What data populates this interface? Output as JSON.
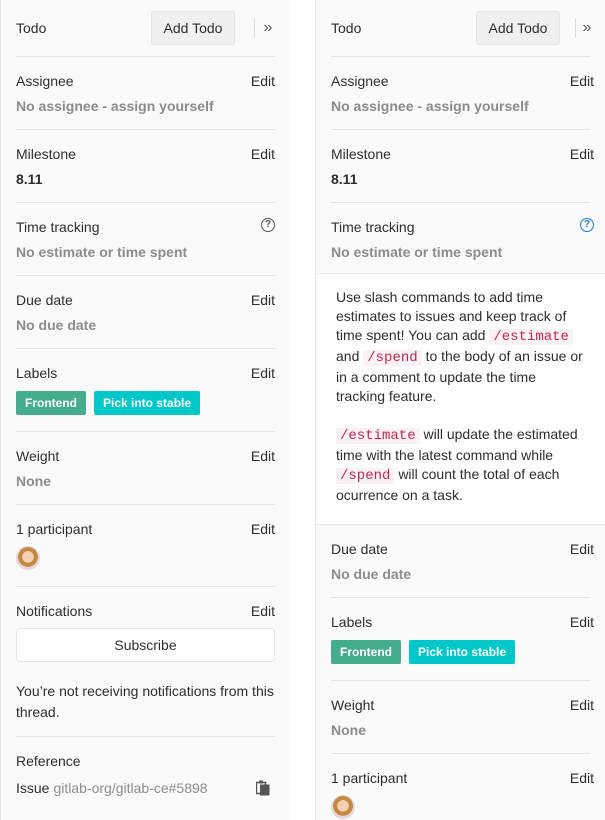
{
  "todo": {
    "label": "Todo",
    "button": "Add Todo"
  },
  "assignee": {
    "title": "Assignee",
    "edit": "Edit",
    "value": "No assignee - assign yourself"
  },
  "milestone": {
    "title": "Milestone",
    "edit": "Edit",
    "value": "8.11"
  },
  "time_tracking": {
    "title": "Time tracking",
    "value": "No estimate or time spent"
  },
  "due_date": {
    "title": "Due date",
    "edit": "Edit",
    "value": "No due date"
  },
  "labels": {
    "title": "Labels",
    "edit": "Edit",
    "items": [
      {
        "text": "Frontend",
        "color": "#44ad8e"
      },
      {
        "text": "Pick into stable",
        "color": "#00c8ca"
      }
    ]
  },
  "weight": {
    "title": "Weight",
    "edit": "Edit",
    "value": "None"
  },
  "participants": {
    "title": "1 participant",
    "edit": "Edit"
  },
  "notifications": {
    "title": "Notifications",
    "edit": "Edit",
    "subscribe": "Subscribe",
    "status": "You’re not receiving notifications from this thread."
  },
  "reference": {
    "title": "Reference",
    "type": "Issue",
    "id": "gitlab-org/gitlab-ce#5898"
  },
  "help": {
    "p1_a": "Use slash commands to add time estimates to issues and keep track of time spent! You can add",
    "p1_code1": "/estimate",
    "p1_b": "and",
    "p1_code2": "/spend",
    "p1_c": "to the body of an issue or in a comment to update the time tracking feature.",
    "p2_code1": "/estimate",
    "p2_a": "will update the estimated time with the latest command while",
    "p2_code2": "/spend",
    "p2_b": "will count the total of each ocurrence on a task."
  },
  "icons": {
    "collapse": "double-chevron-right-icon",
    "help": "question-circle-icon",
    "copy": "clipboard-icon"
  },
  "colors": {
    "accent_blue": "#1f78d1",
    "code_red": "#c7254e"
  }
}
